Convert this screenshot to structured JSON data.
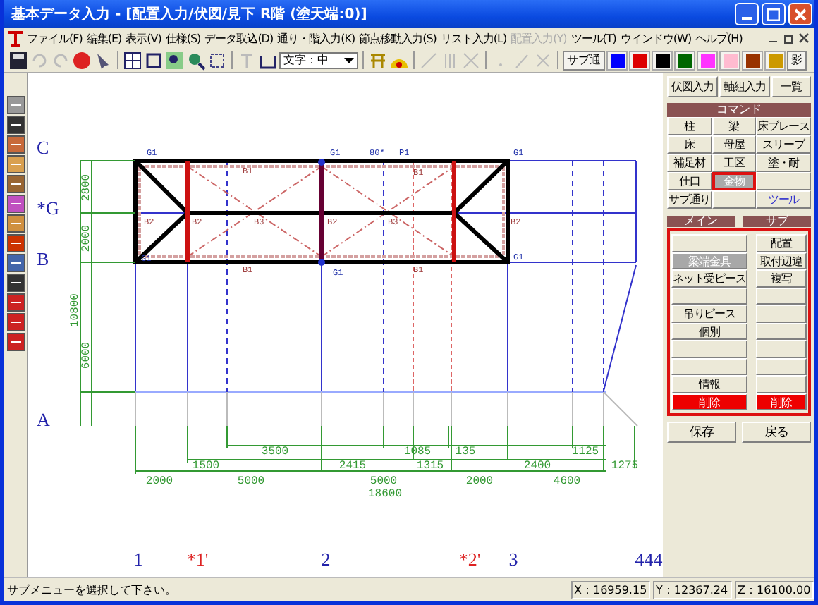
{
  "window": {
    "title": "基本データ入力 - [配置入力/伏図/見下 R階 (塗天端:0)]"
  },
  "menu": [
    {
      "label": "ファイル(F)",
      "disabled": false
    },
    {
      "label": "編集(E)",
      "disabled": false
    },
    {
      "label": "表示(V)",
      "disabled": false
    },
    {
      "label": "仕様(S)",
      "disabled": false
    },
    {
      "label": "データ取込(D)",
      "disabled": false
    },
    {
      "label": "通り・階入力(K)",
      "disabled": false
    },
    {
      "label": "節点移動入力(S)",
      "disabled": false
    },
    {
      "label": "リスト入力(L)",
      "disabled": false
    },
    {
      "label": "配置入力(Y)",
      "disabled": true
    },
    {
      "label": "ツール(T)",
      "disabled": false
    },
    {
      "label": "ウインドウ(W)",
      "disabled": false
    },
    {
      "label": "ヘルプ(H)",
      "disabled": false
    }
  ],
  "toolbar": {
    "text_size": "文字：中",
    "sub_grid": "サブ通",
    "shadow": "影",
    "swatches": [
      {
        "color": "#0000ff"
      },
      {
        "color": "#dd0000"
      },
      {
        "color": "#000000"
      },
      {
        "color": "#006600"
      },
      {
        "color": "#ff33ff"
      },
      {
        "color": "#ffbbd0"
      },
      {
        "color": "#993300"
      },
      {
        "color": "#cc9900"
      }
    ]
  },
  "canvas": {
    "row_axes": [
      {
        "label": "C",
        "color": "#2222aa"
      },
      {
        "label": "*G",
        "color": "#2222aa"
      },
      {
        "label": "B",
        "color": "#2222aa"
      },
      {
        "label": "A",
        "color": "#2222aa"
      }
    ],
    "column_axes": [
      {
        "label": "1",
        "color": "#2222aa"
      },
      {
        "label": "*1'",
        "color": "#dd2222"
      },
      {
        "label": "2",
        "color": "#2222aa"
      },
      {
        "label": "*2'",
        "color": "#dd2222"
      },
      {
        "label": "3",
        "color": "#2222aa"
      },
      {
        "label": "444",
        "color": "#2222aa"
      }
    ],
    "vertical_dims": [
      "2800",
      "2000",
      "10800",
      "6000"
    ],
    "dimension_rows": [
      [
        "3500",
        "1085",
        "135",
        "1125"
      ],
      [
        "1500",
        "2415",
        "1315",
        "2400",
        "1275"
      ],
      [
        "2000",
        "5000",
        "5000",
        "2000",
        "4600"
      ],
      [
        "18600"
      ]
    ],
    "member_labels": [
      "G1",
      "G1",
      "G1",
      "G1",
      "G1",
      "G1",
      "80*",
      "P1",
      "B1",
      "B1",
      "B1",
      "B1",
      "B2",
      "B2",
      "B3",
      "B2",
      "B3",
      "B2"
    ]
  },
  "panel": {
    "tabs": [
      "伏図入力",
      "軸組入力",
      "一覧"
    ],
    "command_header": "コマンド",
    "commands": [
      {
        "kind": "command",
        "label": "柱",
        "selected": false
      },
      {
        "kind": "command",
        "label": "梁",
        "selected": false
      },
      {
        "kind": "command",
        "label": "床ブレース",
        "selected": false
      },
      {
        "kind": "command",
        "label": "床",
        "selected": false
      },
      {
        "kind": "command",
        "label": "母屋",
        "selected": false
      },
      {
        "kind": "command",
        "label": "スリーブ",
        "selected": false
      },
      {
        "kind": "command",
        "label": "補足材",
        "selected": false
      },
      {
        "kind": "command",
        "label": "工区",
        "selected": false
      },
      {
        "kind": "command",
        "label": "塗・耐",
        "selected": false
      },
      {
        "kind": "command",
        "label": "仕口",
        "selected": false
      },
      {
        "kind": "command",
        "label": "金物",
        "selected": true
      },
      {
        "kind": "blank"
      },
      {
        "kind": "command",
        "label": "サブ通り",
        "selected": false
      },
      {
        "kind": "blank"
      },
      {
        "kind": "tool",
        "label": "ツール"
      }
    ],
    "main_header": "メイン",
    "sub_header": "サブ",
    "main_items": [
      {
        "kind": "blank"
      },
      {
        "kind": "item",
        "label": "梁端金具",
        "selected": true
      },
      {
        "kind": "item",
        "label": "ネット受ピース",
        "selected": false
      },
      {
        "kind": "blank"
      },
      {
        "kind": "item",
        "label": "吊りピース",
        "selected": false
      },
      {
        "kind": "item",
        "label": "個別",
        "selected": false
      },
      {
        "kind": "blank"
      },
      {
        "kind": "blank"
      },
      {
        "kind": "item",
        "label": "情報",
        "selected": false
      },
      {
        "kind": "delete",
        "label": "削除"
      }
    ],
    "sub_items": [
      {
        "kind": "item",
        "label": "配置",
        "selected": false
      },
      {
        "kind": "item",
        "label": "取付辺違",
        "selected": false
      },
      {
        "kind": "item",
        "label": "複写",
        "selected": false
      },
      {
        "kind": "blank"
      },
      {
        "kind": "blank"
      },
      {
        "kind": "blank"
      },
      {
        "kind": "blank"
      },
      {
        "kind": "blank"
      },
      {
        "kind": "blank"
      },
      {
        "kind": "delete",
        "label": "削除"
      }
    ],
    "bottom_buttons": [
      "保存",
      "戻る"
    ]
  },
  "status_bar": {
    "message": "サブメニューを選択して下さい。",
    "x": "X：16959.15",
    "y": "Y：12367.24",
    "z": "Z：16100.00"
  }
}
